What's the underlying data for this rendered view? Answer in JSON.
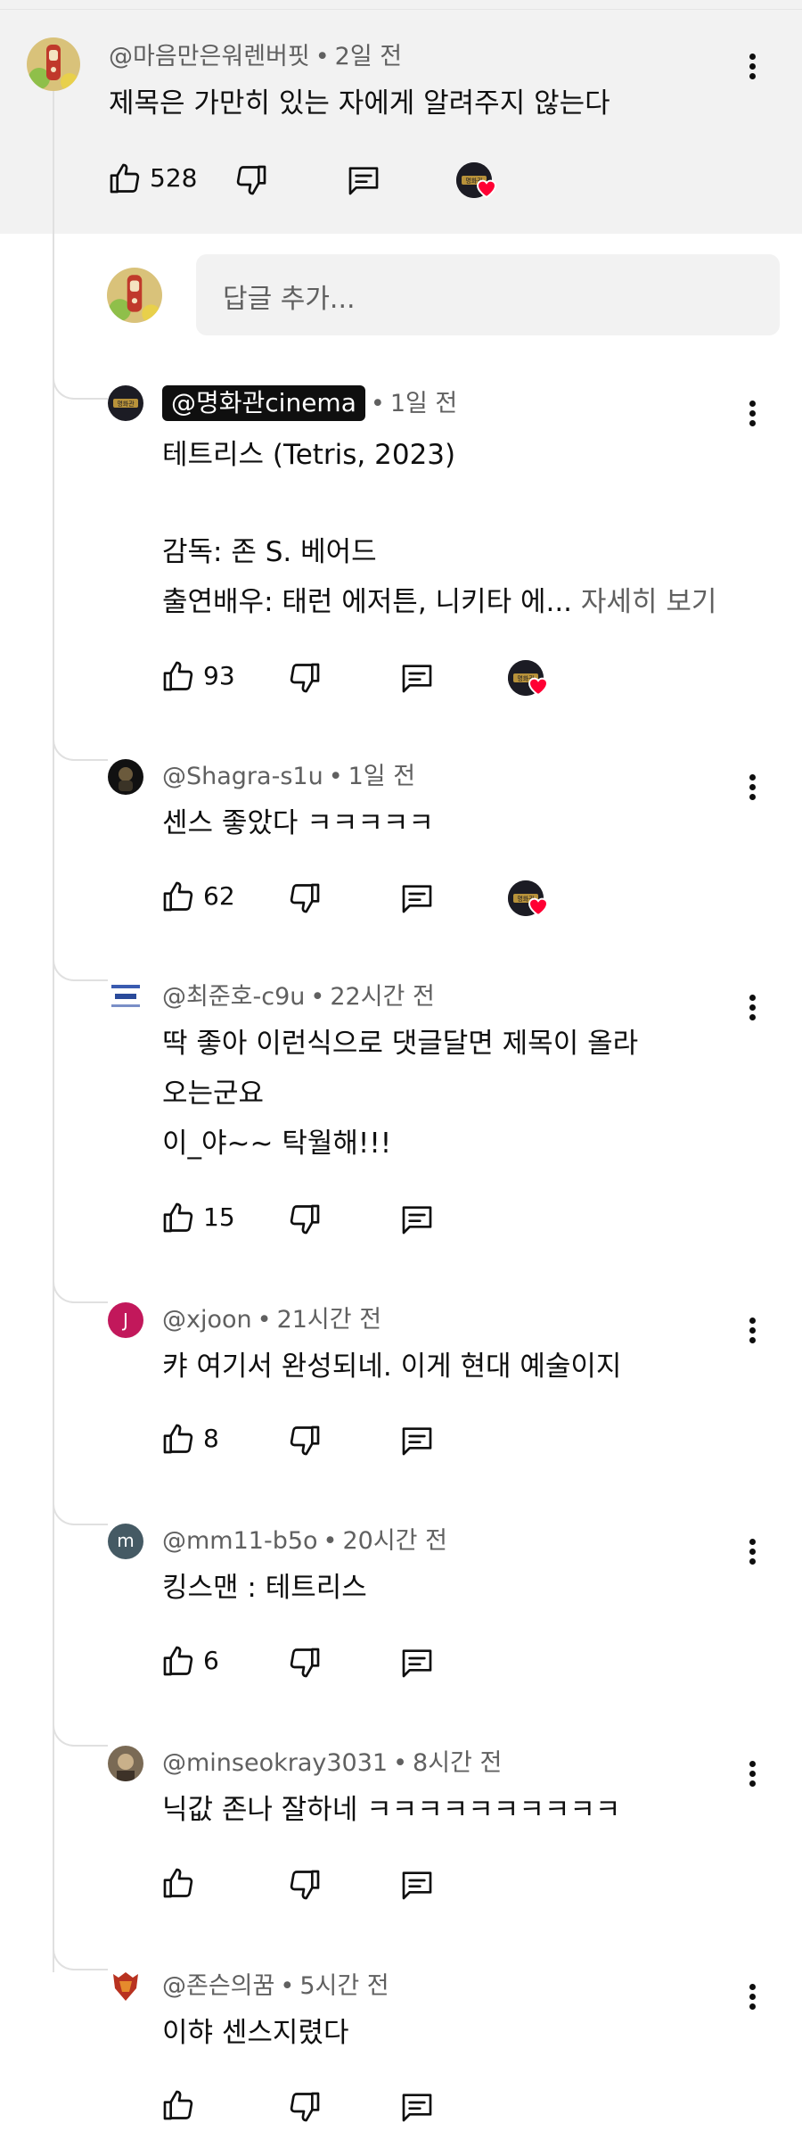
{
  "parent": {
    "author": "@마음만은워렌버핏",
    "time": "2일 전",
    "text": "제목은 가만히 있는 자에게 알려주지 않는다",
    "likes": "528"
  },
  "reply_input": {
    "placeholder": "답글 추가..."
  },
  "replies": [
    {
      "author": "@명화관cinema",
      "time": "1일 전",
      "lines": [
        "테트리스 (Tetris, 2023)",
        "",
        "감독: 존 S. 베어드",
        "출연배우: 태런 에저튼, 니키타 에..."
      ],
      "more_label": "자세히 보기",
      "likes": "93",
      "hearted": true
    },
    {
      "author": "@Shagra-s1u",
      "time": "1일 전",
      "lines": [
        "센스 좋았다 ㅋㅋㅋㅋㅋ"
      ],
      "likes": "62",
      "hearted": true
    },
    {
      "author": "@최준호-c9u",
      "time": "22시간 전",
      "lines": [
        "딱 좋아 이런식으로 댓글달면 제목이 올라",
        "오는군요",
        "이_야~~ 탁월해!!!"
      ],
      "likes": "15",
      "hearted": false
    },
    {
      "author": "@xjoon",
      "time": "21시간 전",
      "avatar_letter": "J",
      "lines": [
        "캬 여기서 완성되네. 이게 현대 예술이지"
      ],
      "likes": "8",
      "hearted": false
    },
    {
      "author": "@mm11-b5o",
      "time": "20시간 전",
      "avatar_letter": "m",
      "lines": [
        "킹스맨 : 테트리스"
      ],
      "likes": "6",
      "hearted": false
    },
    {
      "author": "@minseokray3031",
      "time": "8시간 전",
      "lines": [
        "닉값 존나 잘하네 ㅋㅋㅋㅋㅋㅋㅋㅋㅋㅋ"
      ],
      "likes": "",
      "hearted": false
    },
    {
      "author": "@존슨의꿈",
      "time": "5시간 전",
      "lines": [
        "이햐 센스지렸다"
      ],
      "likes": "",
      "hearted": false
    }
  ],
  "colors": {
    "heart": "#ff0033",
    "xjoon_avatar": "#c2185b",
    "mm11_avatar": "#455a64",
    "thread_line": "#e0e0e0"
  },
  "icons": [
    "thumb-up-icon",
    "thumb-down-icon",
    "reply-icon",
    "more-vert-icon",
    "heart-icon"
  ]
}
